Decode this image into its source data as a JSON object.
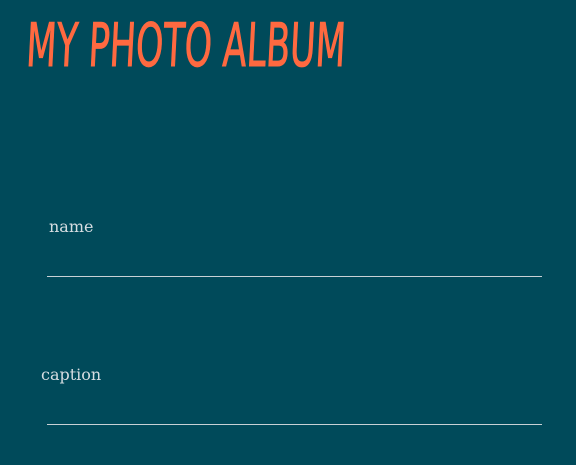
{
  "header": {
    "title": "MY PHOTO ALBUM"
  },
  "form": {
    "name": {
      "label": "name",
      "value": "",
      "placeholder": ""
    },
    "caption": {
      "label": "caption",
      "value": "",
      "placeholder": ""
    }
  },
  "colors": {
    "background": "#004a5a",
    "title": "#ff6940",
    "label": "#d6dde1",
    "underline": "#c8d1d5"
  }
}
